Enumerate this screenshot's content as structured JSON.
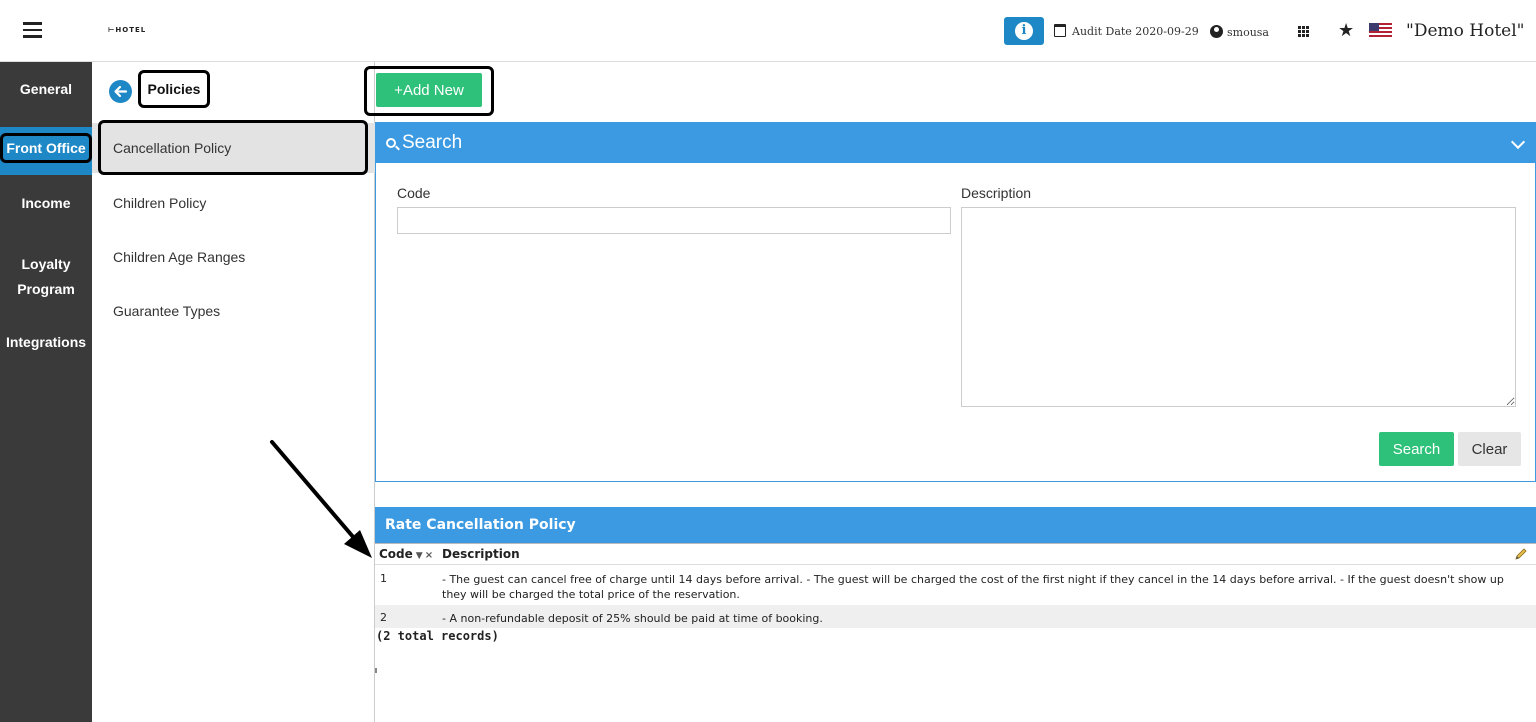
{
  "header": {
    "logo_text": "HOTEL",
    "info_label": "i",
    "audit_date": "Audit Date 2020-09-29",
    "username": "smousa",
    "hotel_name": "\"Demo Hotel\""
  },
  "leftnav": {
    "items": [
      {
        "label": "General"
      },
      {
        "label": "Front Office"
      },
      {
        "label": "Income"
      },
      {
        "label": "Loyalty"
      },
      {
        "label": "Program"
      },
      {
        "label": "Integrations"
      }
    ]
  },
  "subnav": {
    "title": "Policies",
    "items": [
      {
        "label": "Cancellation Policy"
      },
      {
        "label": "Children Policy"
      },
      {
        "label": "Children Age Ranges"
      },
      {
        "label": "Guarantee Types"
      }
    ]
  },
  "toolbar": {
    "add_label": "Add New"
  },
  "search": {
    "title": "Search",
    "code_label": "Code",
    "code_value": "",
    "description_label": "Description",
    "description_value": "",
    "search_button": "Search",
    "clear_button": "Clear"
  },
  "grid": {
    "title": "Rate Cancellation Policy",
    "columns": {
      "code": "Code",
      "description": "Description"
    },
    "sort_indicator": "▼",
    "clear_sort": "×",
    "rows": [
      {
        "code": "1",
        "description": "- The guest can cancel free of charge until 14 days before arrival. - The guest will be charged the cost of the first night if they cancel in the 14 days before arrival. - If the guest doesn't show up they will be charged the total price of the reservation."
      },
      {
        "code": "2",
        "description": "- A non-refundable deposit of 25% should be paid at time of booking."
      }
    ],
    "total": "(2 total records)"
  },
  "colors": {
    "primary_blue": "#3b9ae1",
    "nav_dark": "#3a3a3a",
    "green": "#2ec17a"
  }
}
